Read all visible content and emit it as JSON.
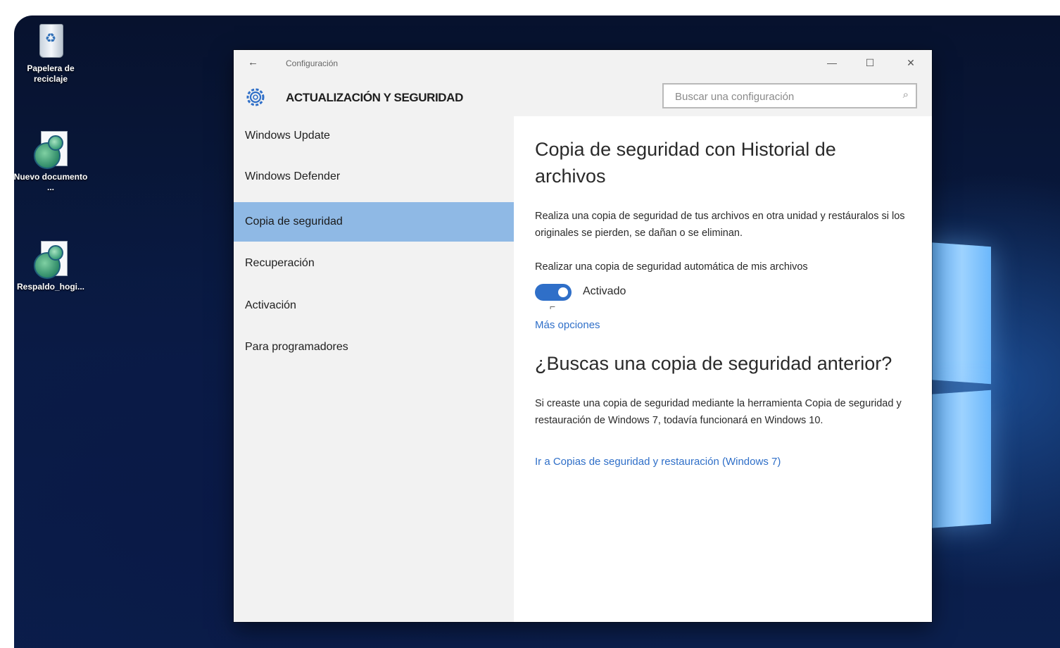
{
  "desktop": {
    "icons": [
      {
        "label": "Papelera de reciclaje",
        "icon": "recycle-bin-icon"
      },
      {
        "label": "Nuevo documento ...",
        "icon": "document-gears-icon"
      },
      {
        "label": "Respaldo_hogi...",
        "icon": "document-gears-icon"
      }
    ]
  },
  "window": {
    "title": "Configuración",
    "back_icon": "←",
    "controls": {
      "minimize": "—",
      "maximize": "☐",
      "close": "✕"
    }
  },
  "header": {
    "title": "ACTUALIZACIÓN Y SEGURIDAD",
    "search_placeholder": "Buscar una configuración",
    "search_icon": "⌕"
  },
  "sidebar": {
    "items": [
      {
        "label": "Windows Update",
        "active": false
      },
      {
        "label": "Windows Defender",
        "active": false
      },
      {
        "label": "Copia de seguridad",
        "active": true
      },
      {
        "label": "Recuperación",
        "active": false
      },
      {
        "label": "Activación",
        "active": false
      },
      {
        "label": "Para programadores",
        "active": false
      }
    ]
  },
  "content": {
    "title": "Copia de seguridad con Historial de archivos",
    "description": "Realiza una copia de seguridad de tus archivos en otra unidad y restáuralos si los originales se pierden, se dañan o se eliminan.",
    "toggle_label": "Realizar una copia de seguridad automática de mis archivos",
    "toggle_state": "Activado",
    "more_options": "Más opciones",
    "older_title": "¿Buscas una copia de seguridad anterior?",
    "older_description": "Si creaste una copia de seguridad mediante la herramienta Copia de seguridad y restauración de Windows 7, todavía funcionará en Windows 10.",
    "win7_link": "Ir a Copias de seguridad y restauración (Windows 7)"
  },
  "colors": {
    "accent": "#2f6fc8",
    "nav_active": "#8fb9e5",
    "pane_bg": "#f2f2f2"
  }
}
